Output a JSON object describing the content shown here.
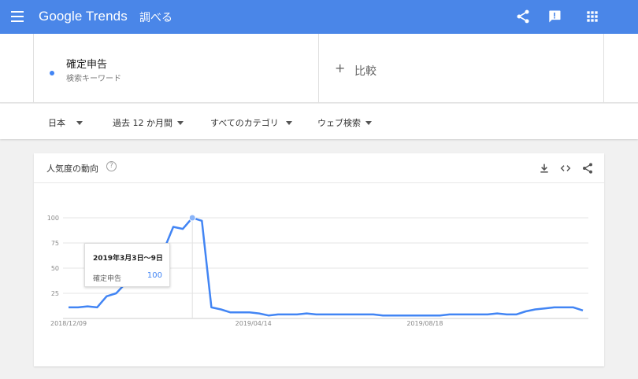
{
  "header": {
    "brand": "Google Trends",
    "section": "調べる",
    "icons": [
      "hamburger-menu-icon",
      "share-icon",
      "feedback-icon",
      "apps-grid-icon"
    ]
  },
  "search_term": {
    "name": "確定申告",
    "type": "検索キーワード",
    "color": "#4285f4"
  },
  "compare": {
    "plus": "+",
    "label": "比較"
  },
  "filters": {
    "region": "日本",
    "time": "過去 12 か月間",
    "category": "すべてのカテゴリ",
    "property": "ウェブ検索"
  },
  "card": {
    "title": "人気度の動向",
    "help": "?",
    "icons": [
      "download-icon",
      "embed-icon",
      "share-icon"
    ]
  },
  "tooltip": {
    "date": "2019年3月3日〜9日",
    "term": "確定申告",
    "value": "100"
  },
  "chart_data": {
    "type": "line",
    "yticks": [
      "25",
      "50",
      "75",
      "100"
    ],
    "ylim": [
      0,
      100
    ],
    "xticks": [
      "2018/12/09",
      "2019/04/14",
      "2019/08/18"
    ],
    "series": [
      {
        "name": "確定申告",
        "color": "#4285f4",
        "values": [
          11,
          11,
          12,
          11,
          22,
          25,
          35,
          41,
          49,
          58,
          68,
          91,
          89,
          100,
          97,
          11,
          9,
          6,
          6,
          6,
          5,
          3,
          4,
          4,
          4,
          5,
          4,
          4,
          4,
          4,
          4,
          4,
          4,
          3,
          3,
          3,
          3,
          3,
          3,
          3,
          4,
          4,
          4,
          4,
          4,
          5,
          4,
          4,
          7,
          9,
          10,
          11,
          11,
          11,
          8
        ]
      }
    ],
    "highlight_index": 13
  }
}
